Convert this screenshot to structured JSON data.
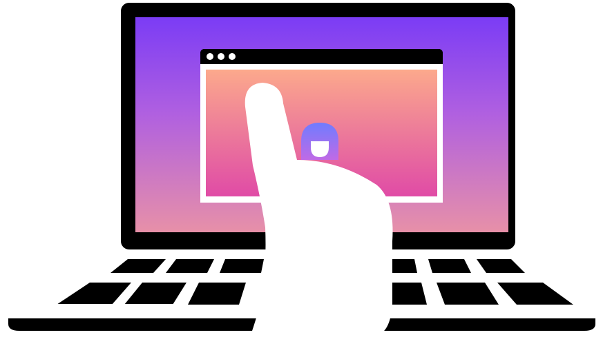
{
  "illustration": {
    "subject": "laptop-video-call-hand-icon",
    "colors": {
      "outline": "#000000",
      "background": "#ffffff",
      "screen_gradient": [
        "#7b3cf5",
        "#b060e0",
        "#e790a8"
      ],
      "window_gradient": [
        "#fca98c",
        "#ec7a9a",
        "#e04ba6"
      ],
      "avatar_gradient": [
        "#6f7cff",
        "#c06ae6"
      ],
      "hand": "#ffffff"
    },
    "window_control_dots": 3
  }
}
